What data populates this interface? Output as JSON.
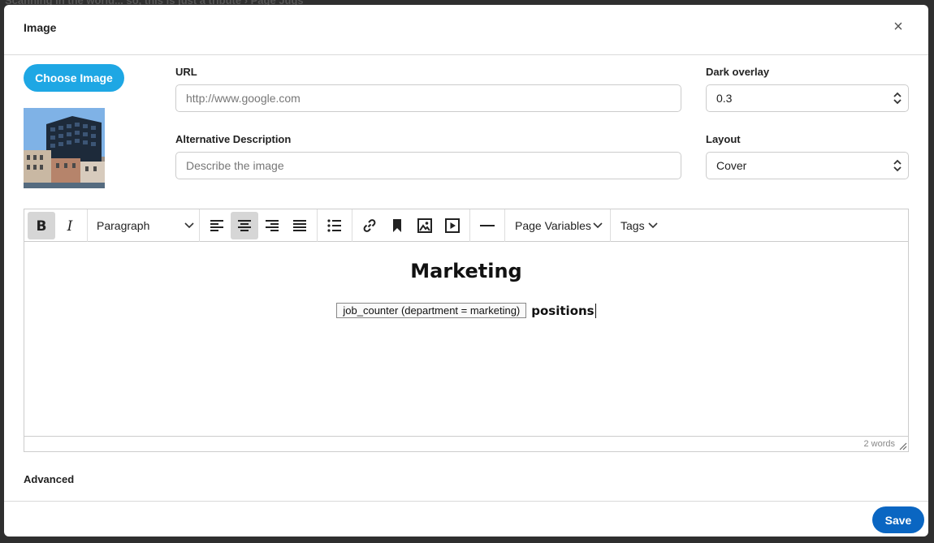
{
  "background": {
    "text": "Scanning in the world... so, this is just a tribute  ›  Page Jugs"
  },
  "modal": {
    "title": "Image",
    "close_icon": "×"
  },
  "image_panel": {
    "choose_label": "Choose Image",
    "url_label": "URL",
    "url_placeholder": "http://www.google.com",
    "alt_label": "Alternative Description",
    "alt_placeholder": "Describe the image",
    "overlay_label": "Dark overlay",
    "overlay_value": "0.3",
    "layout_label": "Layout",
    "layout_value": "Cover"
  },
  "toolbar": {
    "block_format": "Paragraph",
    "page_variables": "Page Variables",
    "tags": "Tags",
    "icons": [
      "bold-icon",
      "italic-icon",
      "align-left-icon",
      "align-center-icon",
      "align-right-icon",
      "align-justify-icon",
      "bullet-list-icon",
      "link-icon",
      "bookmark-icon",
      "image-icon",
      "media-icon",
      "horizontal-rule-icon"
    ]
  },
  "editor": {
    "heading": "Marketing",
    "chip": "job_counter (department = marketing)",
    "trailing_text": "positions",
    "word_count": "2 words"
  },
  "advanced_label": "Advanced",
  "footer": {
    "save_label": "Save"
  },
  "colors": {
    "primary": "#0a66c2",
    "choose": "#1ea7e4"
  }
}
